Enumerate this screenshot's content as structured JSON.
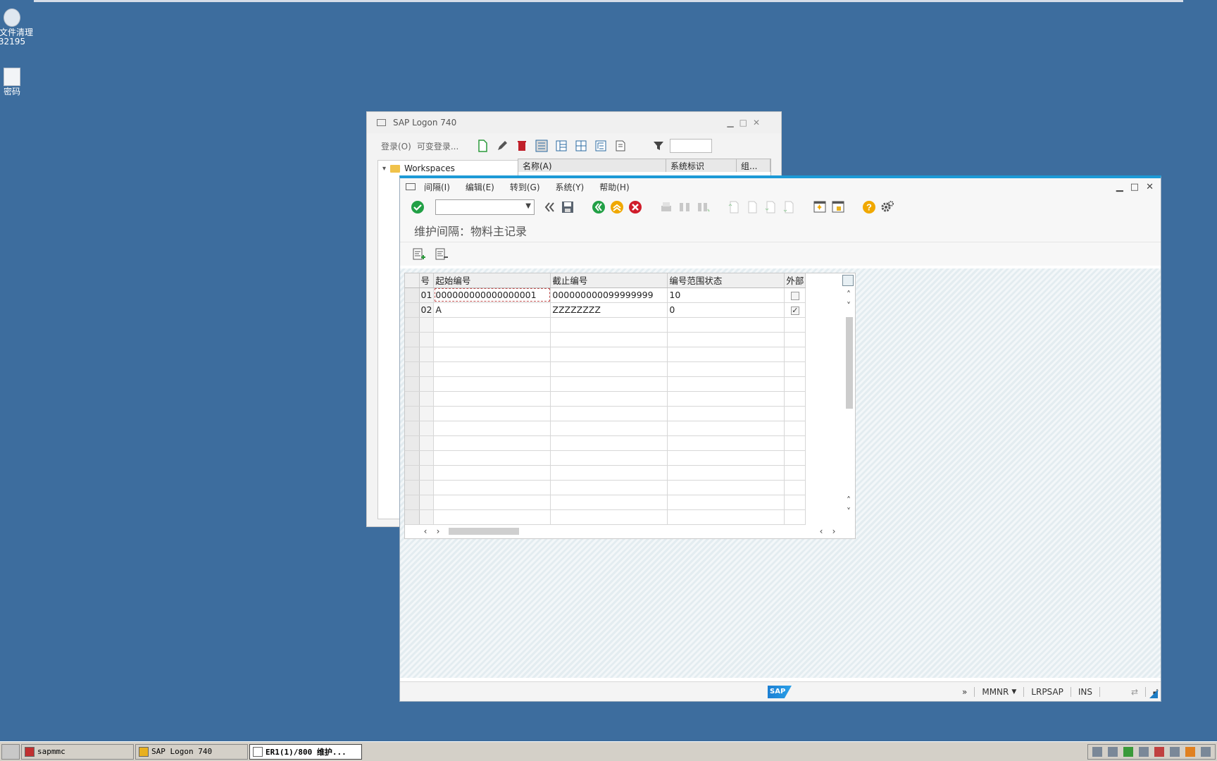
{
  "desktop": {
    "icons": [
      {
        "label": "级文件清理",
        "sublabel": "32195"
      },
      {
        "label": "密码"
      }
    ]
  },
  "logon_window": {
    "title": "SAP Logon 740",
    "toolbar": {
      "logon_label": "登录(O)",
      "variable_logon_label": "可变登录..."
    },
    "tree": {
      "root": "Workspaces"
    },
    "list_headers": [
      "名称(A)",
      "系统标识",
      "组..."
    ]
  },
  "main_window": {
    "menu": [
      "间隔(I)",
      "编辑(E)",
      "转到(G)",
      "系统(Y)",
      "帮助(H)"
    ],
    "screen_title": "维护间隔：物料主记录",
    "table": {
      "headers": [
        "号",
        "起始编号",
        "截止编号",
        "编号范围状态",
        "外部"
      ],
      "rows": [
        {
          "no": "01",
          "from": "000000000000000001",
          "to": "000000000099999999",
          "status": "10",
          "external": false
        },
        {
          "no": "02",
          "from": "A",
          "to": "ZZZZZZZZ",
          "status": "0",
          "external": true
        }
      ]
    },
    "status": {
      "tcode": "MMNR",
      "server": "LRPSAP",
      "mode": "INS"
    }
  },
  "taskbar": {
    "tasks": [
      "sapmmc",
      "SAP Logon 740",
      "ER1(1)/800 维护..."
    ]
  },
  "colors": {
    "desktop": "#3d6d9e",
    "accent": "#1d9ad6"
  }
}
